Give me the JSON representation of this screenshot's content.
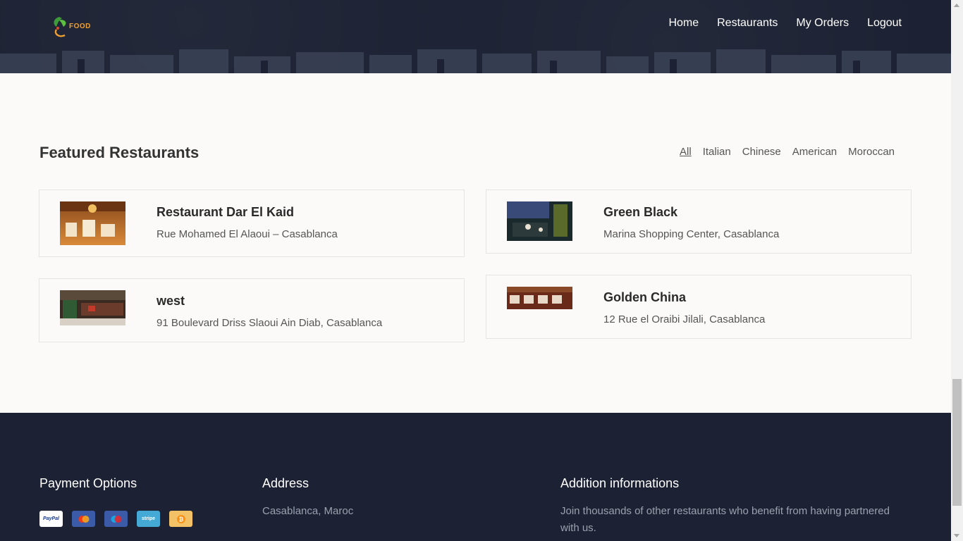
{
  "header": {
    "logo_text": "FOOD",
    "nav": [
      "Home",
      "Restaurants",
      "My Orders",
      "Logout"
    ]
  },
  "featured": {
    "title": "Featured Restaurants",
    "filters": [
      "All",
      "Italian",
      "Chinese",
      "American",
      "Moroccan"
    ],
    "active_filter": "All",
    "restaurants": [
      {
        "name": "Restaurant Dar El Kaid",
        "address": "Rue Mohamed El Alaoui – Casablanca"
      },
      {
        "name": "Green Black",
        "address": "Marina Shopping Center, Casablanca"
      },
      {
        "name": "west",
        "address": "91 Boulevard Driss Slaoui Ain Diab, Casablanca"
      },
      {
        "name": "Golden China",
        "address": "12 Rue el Oraibi Jilali, Casablanca"
      }
    ]
  },
  "footer": {
    "payment_title": "Payment Options",
    "payment_methods": [
      "PayPal",
      "Mastercard",
      "Maestro",
      "stripe",
      "Bitcoin"
    ],
    "address_title": "Address",
    "address_text": "Casablanca, Maroc",
    "info_title": "Addition informations",
    "info_text": "Join thousands of other restaurants who benefit from having partnered with us."
  },
  "colors": {
    "dark_bg": "#1c2233",
    "page_bg": "#fbfaf8",
    "logo_accent": "#f0a030"
  }
}
